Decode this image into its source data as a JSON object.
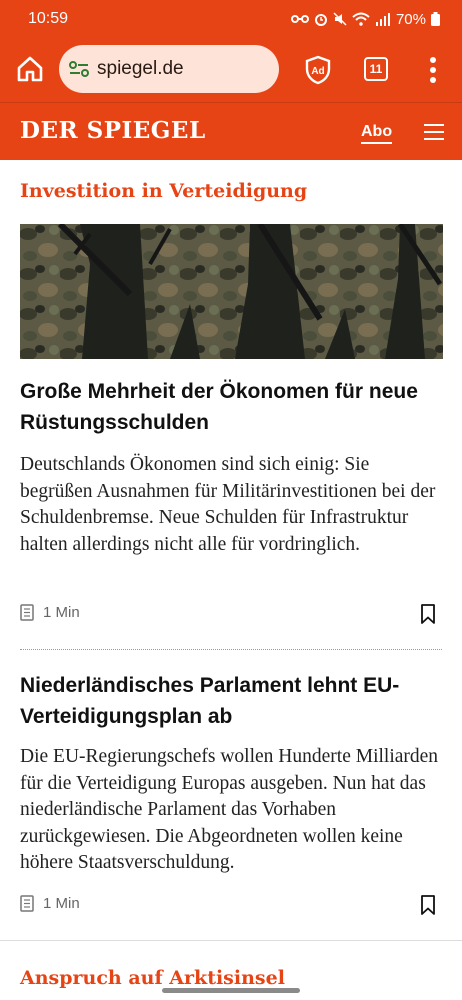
{
  "status": {
    "time": "10:59",
    "battery": "70%",
    "icons": [
      "key-icon",
      "alarm-icon",
      "mute-icon",
      "wifi-icon",
      "signal-icon",
      "battery-icon"
    ]
  },
  "browser": {
    "url": "spiegel.de",
    "tab_count": "11",
    "icons": [
      "home-icon",
      "site-settings-icon",
      "adblock-shield-icon",
      "tabs-icon",
      "overflow-menu-icon"
    ]
  },
  "header": {
    "logo": "DER SPIEGEL",
    "abo_label": "Abo",
    "menu_icon": "hamburger-icon"
  },
  "section": {
    "title": "Investition in Verteidigung"
  },
  "articles": [
    {
      "headline": "Große Mehrheit der Ökonomen für neue Rüstungsschulden",
      "teaser": "Deutschlands Ökonomen sind sich einig: Sie begrüßen Ausnahmen für Militärinvestitionen bei der Schuldenbremse. Neue Schulden für Infrastruktur halten allerdings nicht alle für vordringlich.",
      "reading_time": "1 Min"
    },
    {
      "headline": "Niederländisches Parlament lehnt EU-Verteidigungsplan ab",
      "teaser": "Die EU-Regierungschefs wollen Hunderte Milliarden für die Verteidigung Europas ausgeben. Nun hat das niederländische Parlament das Vorhaben zurückgewiesen. Die Abgeordneten wollen keine höhere Staatsverschuldung.",
      "reading_time": "1 Min"
    }
  ],
  "next_section": {
    "title": "Anspruch auf Arktisinsel"
  },
  "colors": {
    "brand": "#e64415",
    "text": "#111111",
    "background": "#ffffff"
  }
}
